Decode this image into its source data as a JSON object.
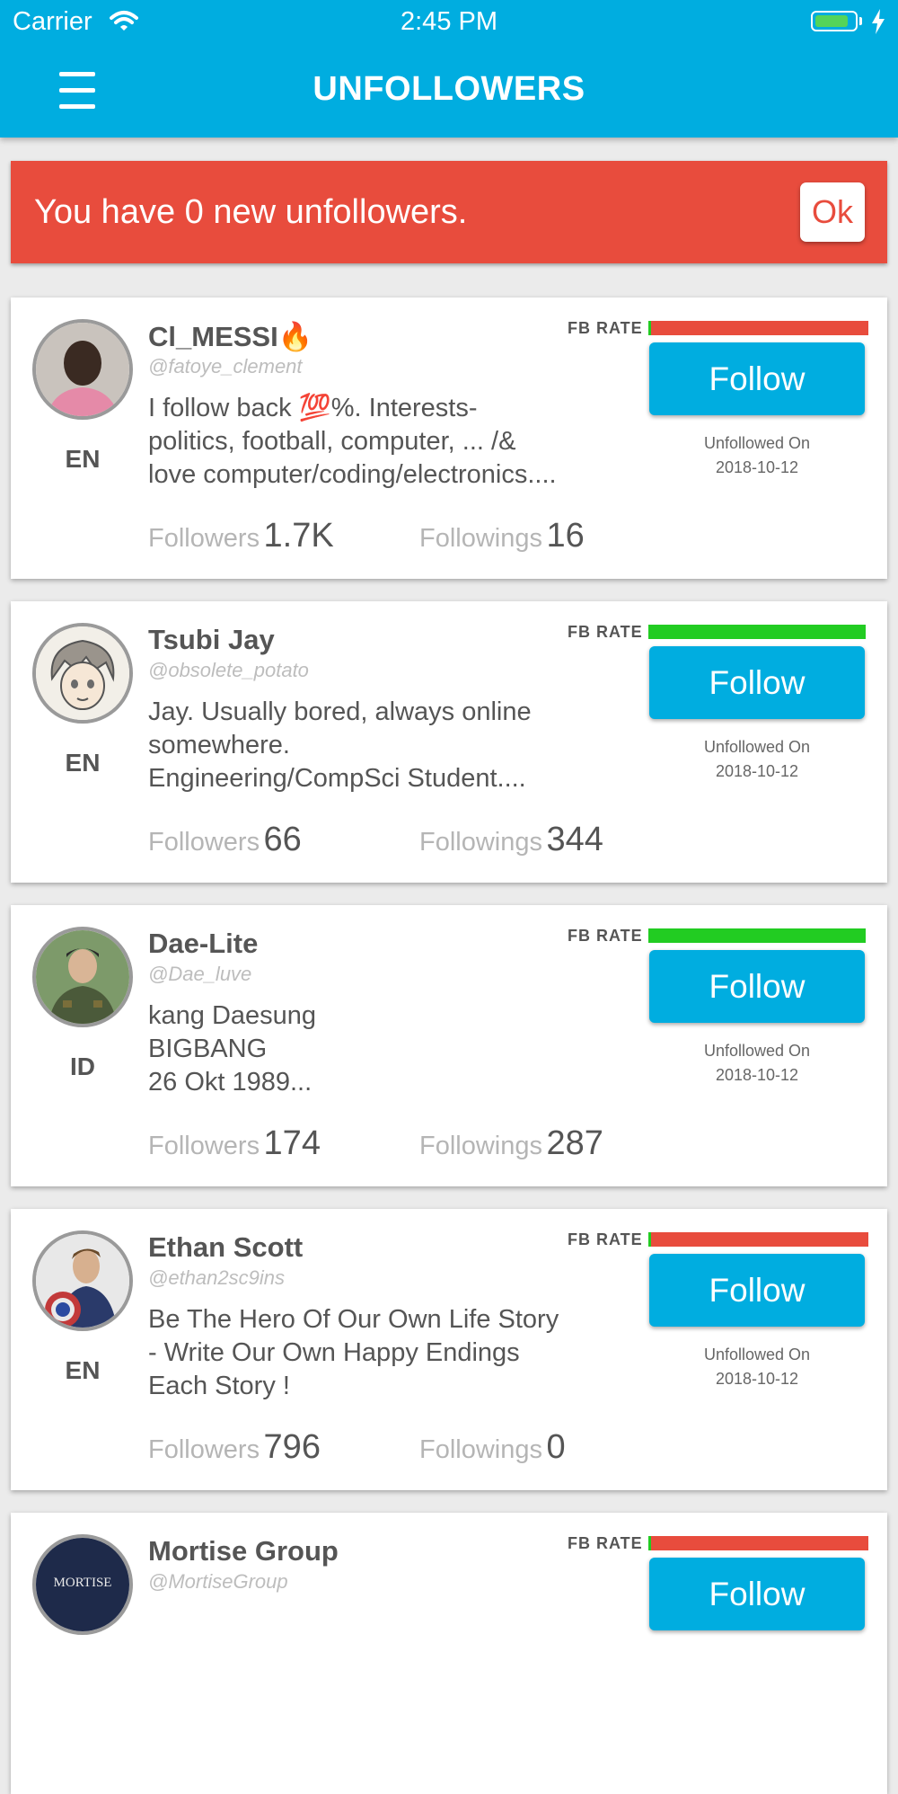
{
  "status_bar": {
    "carrier": "Carrier",
    "time": "2:45 PM",
    "battery_level": 0.85
  },
  "nav": {
    "title": "UNFOLLOWERS",
    "menu_icon": "hamburger-menu-icon"
  },
  "alert": {
    "message": "You have 0 new unfollowers.",
    "ok_label": "Ok",
    "color": "#e84c3d"
  },
  "colors": {
    "brand": "#00ade0",
    "rate_good": "#22cc22",
    "rate_bad": "#e84c3d"
  },
  "cards": [
    {
      "name": "Cl_MESSI🔥",
      "handle": "@fatoye_clement",
      "lang": "EN",
      "bio": "I follow back 💯%. Interests-\npolitics, football, computer, ... /&\nlove computer/coding/electronics....",
      "followers_label": "Followers",
      "followers": "1.7K",
      "followings_label": "Followings",
      "followings": "16",
      "fb_rate_label": "FB RATE",
      "fb_rate": "bad",
      "follow_label": "Follow",
      "unfollowed_label": "Unfollowed On",
      "unfollowed_date": "2018-10-12"
    },
    {
      "name": "Tsubi Jay",
      "handle": "@obsolete_potato",
      "lang": "EN",
      "bio": "Jay. Usually bored, always online\nsomewhere.\nEngineering/CompSci Student....",
      "followers_label": "Followers",
      "followers": "66",
      "followings_label": "Followings",
      "followings": "344",
      "fb_rate_label": "FB RATE",
      "fb_rate": "good",
      "follow_label": "Follow",
      "unfollowed_label": "Unfollowed On",
      "unfollowed_date": "2018-10-12"
    },
    {
      "name": "Dae-Lite",
      "handle": "@Dae_luve",
      "lang": "ID",
      "bio": "kang Daesung\nBIGBANG\n26 Okt 1989...",
      "followers_label": "Followers",
      "followers": "174",
      "followings_label": "Followings",
      "followings": "287",
      "fb_rate_label": "FB RATE",
      "fb_rate": "good",
      "follow_label": "Follow",
      "unfollowed_label": "Unfollowed On",
      "unfollowed_date": "2018-10-12"
    },
    {
      "name": "Ethan Scott",
      "handle": "@ethan2sc9ins",
      "lang": "EN",
      "bio": "Be The Hero Of  Our Own Life Story\n- Write Our Own Happy Endings\nEach  Story !",
      "followers_label": "Followers",
      "followers": "796",
      "followings_label": "Followings",
      "followings": "0",
      "fb_rate_label": "FB RATE",
      "fb_rate": "bad",
      "follow_label": "Follow",
      "unfollowed_label": "Unfollowed On",
      "unfollowed_date": "2018-10-12"
    },
    {
      "name": "Mortise Group",
      "handle": "@MortiseGroup",
      "avatar_text": "MORTISE",
      "fb_rate_label": "FB RATE",
      "fb_rate": "bad",
      "follow_label": "Follow"
    }
  ]
}
